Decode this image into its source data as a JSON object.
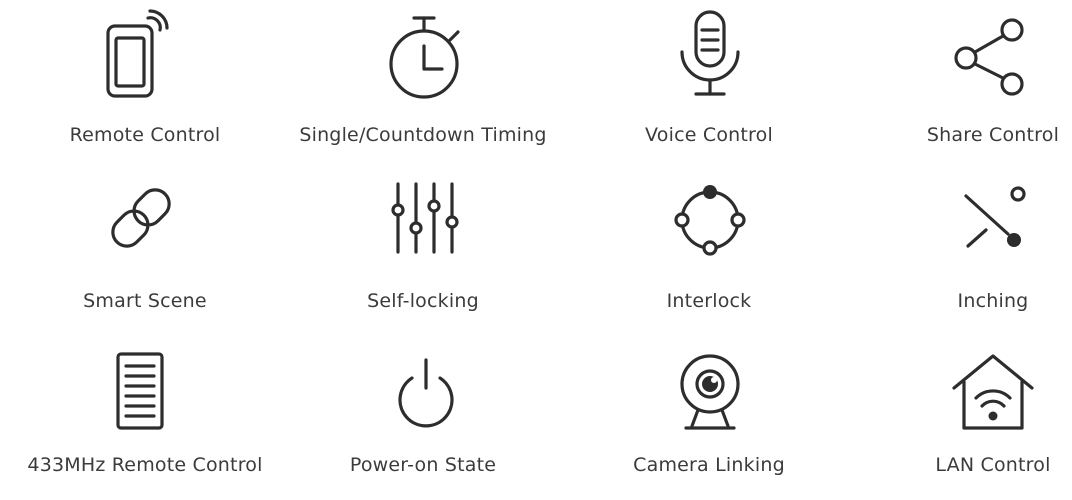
{
  "features": [
    {
      "label": "Remote Control",
      "icon": "smartphone-wifi-icon"
    },
    {
      "label": "Single/Countdown Timing",
      "icon": "stopwatch-icon"
    },
    {
      "label": "Voice Control",
      "icon": "microphone-icon"
    },
    {
      "label": "Share Control",
      "icon": "share-icon"
    },
    {
      "label": "Smart Scene",
      "icon": "link-chain-icon"
    },
    {
      "label": "Self-locking",
      "icon": "equalizer-sliders-icon"
    },
    {
      "label": "Interlock",
      "icon": "interlock-circle-icon"
    },
    {
      "label": "Inching",
      "icon": "inching-switch-icon"
    },
    {
      "label": "433MHz Remote Control",
      "icon": "rf-remote-icon"
    },
    {
      "label": "Power-on State",
      "icon": "power-icon"
    },
    {
      "label": "Camera Linking",
      "icon": "webcam-icon"
    },
    {
      "label": "LAN Control",
      "icon": "home-wifi-icon"
    }
  ],
  "colors": {
    "icon": "#2d2d2d",
    "text": "#3b3b3b",
    "background": "#ffffff"
  }
}
